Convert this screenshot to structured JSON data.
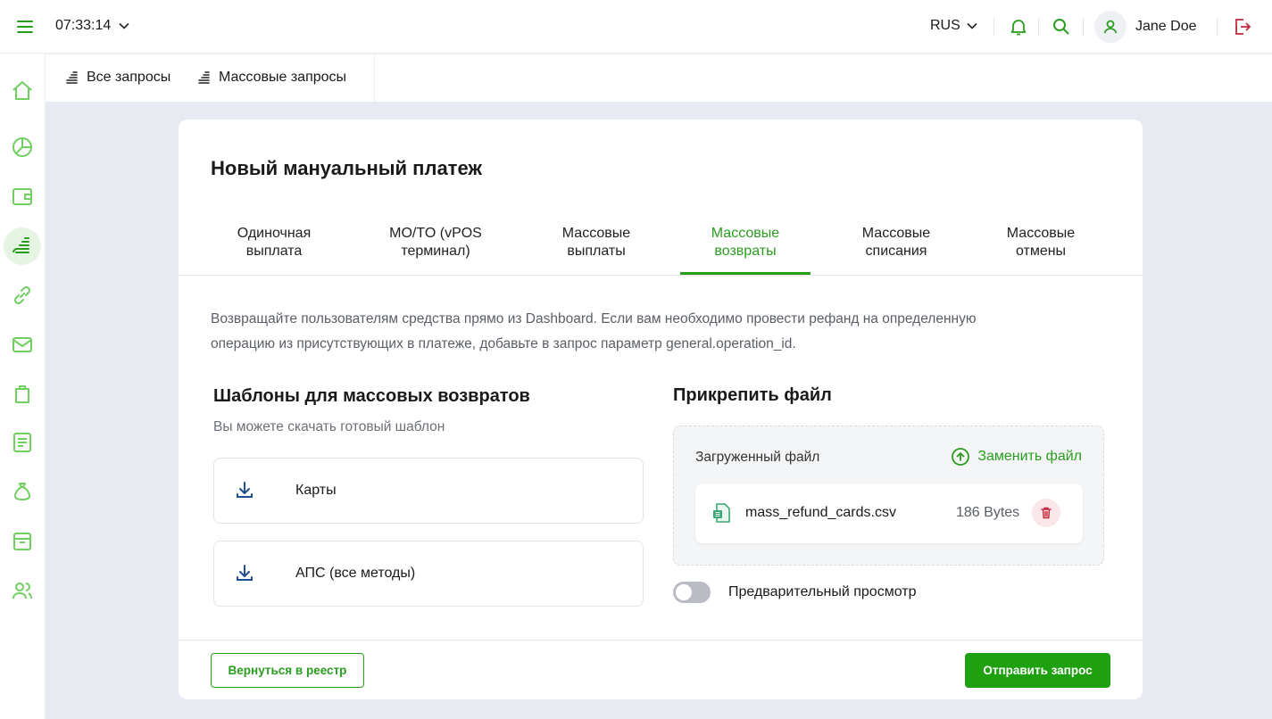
{
  "header": {
    "time": "07:33:14",
    "language": "RUS",
    "user_name": "Jane Doe"
  },
  "subtabs": [
    {
      "label": "Все запросы"
    },
    {
      "label": "Массовые запросы"
    }
  ],
  "card": {
    "title": "Новый мануальный платеж",
    "tabs": [
      {
        "line1": "Одиночная",
        "line2": "выплата"
      },
      {
        "line1": "MO/TO (vPOS",
        "line2": "терминал)"
      },
      {
        "line1": "Массовые",
        "line2": "выплаты"
      },
      {
        "line1": "Массовые",
        "line2": "возвраты"
      },
      {
        "line1": "Массовые",
        "line2": "списания"
      },
      {
        "line1": "Массовые",
        "line2": "отмены"
      }
    ],
    "description_line1": "Возвращайте пользователям средства прямо из Dashboard. Если вам необходимо провести рефанд на определенную",
    "description_line2": "операцию из присутствующих в платеже, добавьте в запрос параметр general.operation_id.",
    "templates": {
      "title": "Шаблоны для массовых возвратов",
      "subtitle": "Вы можете скачать готовый шаблон",
      "items": [
        {
          "label": "Карты"
        },
        {
          "label": "АПС (все методы)"
        }
      ]
    },
    "attach": {
      "title": "Прикрепить файл",
      "uploaded_label": "Загруженный файл",
      "replace_label": "Заменить файл",
      "file_name": "mass_refund_cards.csv",
      "file_size": "186 Bytes"
    },
    "preview_label": "Предварительный просмотр",
    "back_button": "Вернуться в реестр",
    "send_button": "Отправить запрос"
  },
  "colors": {
    "accent": "#2a9d1f",
    "danger": "#c2283a"
  }
}
